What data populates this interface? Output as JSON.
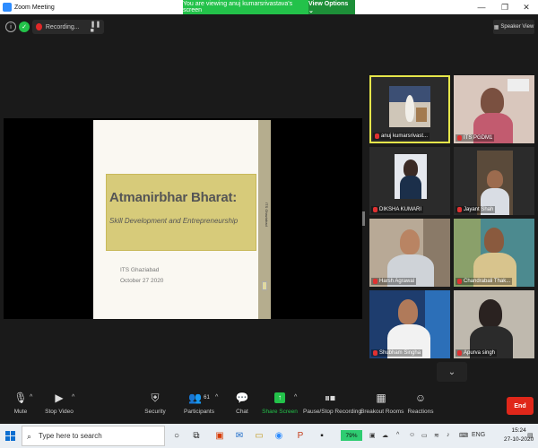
{
  "window": {
    "title": "Zoom Meeting",
    "minimize": "—",
    "restore": "❐",
    "close": "✕"
  },
  "share_banner": {
    "message": "You are viewing anuj kumarsrivastava's screen",
    "view_options": "View Options ⌄"
  },
  "topbar": {
    "info_icon": "i",
    "shield_icon": "✓",
    "recording_label": "Recording...",
    "pause_stop": "❚❚ ■",
    "speaker_view_label": "Speaker View"
  },
  "slide": {
    "title": "Atmanirbhar Bharat:",
    "subtitle": "Skill Development and Entrepreneurship",
    "org": "ITS Ghaziabad",
    "date": "October 27 2020",
    "side_text": "ITS Ghaziabad"
  },
  "participants": [
    {
      "name": "anuj kumarsrivast...",
      "muted": true,
      "active": true
    },
    {
      "name": "ITS PGDM1",
      "muted": true,
      "active": false
    },
    {
      "name": "DIKSHA KUMARI",
      "muted": true,
      "active": false
    },
    {
      "name": "Jayant Shah",
      "muted": true,
      "active": false
    },
    {
      "name": "Harsh Agrawal",
      "muted": true,
      "active": false
    },
    {
      "name": "Chandrabali Thak...",
      "muted": true,
      "active": false
    },
    {
      "name": "Shubham Singha",
      "muted": true,
      "active": false
    },
    {
      "name": "Apurva singh",
      "muted": true,
      "active": false
    }
  ],
  "scroll_down": "⌄",
  "toolbar": {
    "mute": "Mute",
    "stop_video": "Stop Video",
    "security": "Security",
    "participants": "Participants",
    "participants_count": "61",
    "chat": "Chat",
    "share_screen": "Share Screen",
    "record": "Pause/Stop Recording",
    "breakout": "Breakout Rooms",
    "reactions": "Reactions",
    "end": "End",
    "caret": "^"
  },
  "taskbar": {
    "search_placeholder": "Type here to search",
    "battery": "79%",
    "language": "ENG",
    "time": "15:24",
    "date": "27-10-2020"
  },
  "colors": {
    "share_green": "#23c24a",
    "end_red": "#e0271a",
    "active_speaker": "#e6e64a",
    "slide_band": "#d7cb7a"
  }
}
